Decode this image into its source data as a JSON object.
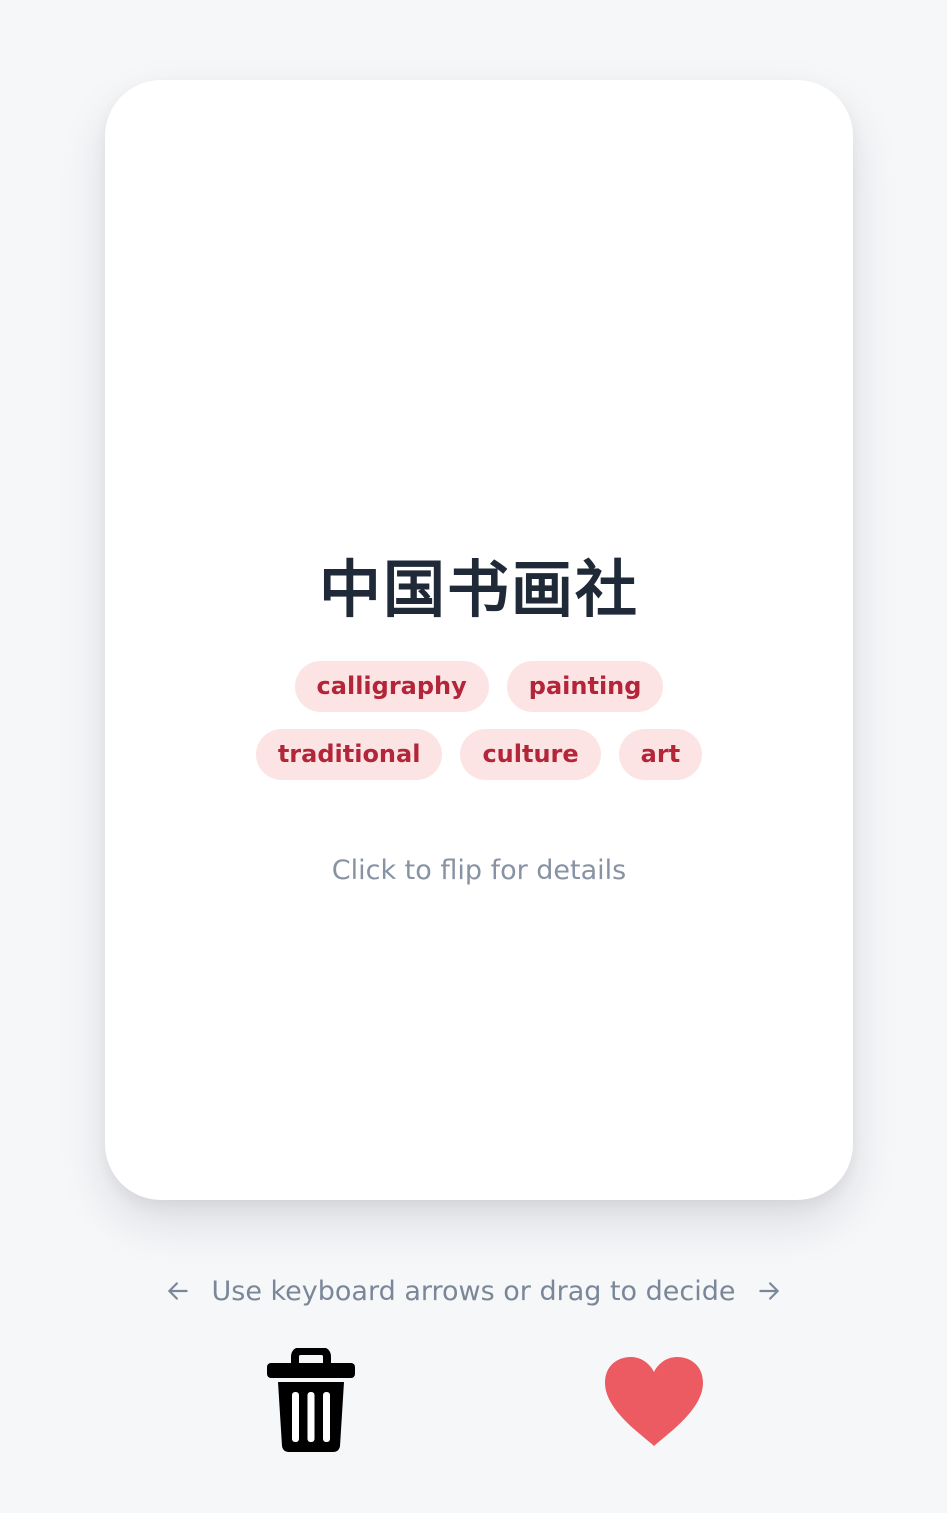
{
  "card": {
    "title": "中国书画社",
    "tags": [
      "calligraphy",
      "painting",
      "traditional",
      "culture",
      "art"
    ],
    "hint": "Click to flip for details"
  },
  "instructions": {
    "text": "Use keyboard arrows or drag to decide",
    "left_icon": "arrow-left-icon",
    "right_icon": "arrow-right-icon"
  },
  "actions": {
    "discard_icon": "trash-icon",
    "like_icon": "heart-icon"
  },
  "colors": {
    "background": "#f6f7f9",
    "card": "#ffffff",
    "title": "#1f2937",
    "tag_bg": "#fde4e4",
    "tag_text": "#b3263a",
    "hint": "#8792a2",
    "heart": "#ec5a62",
    "trash": "#000000"
  }
}
